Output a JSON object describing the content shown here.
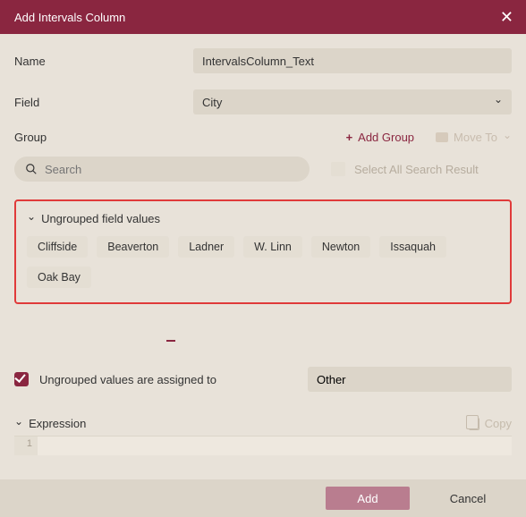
{
  "titlebar": {
    "title": "Add Intervals Column"
  },
  "fields": {
    "name_label": "Name",
    "name_value": "IntervalsColumn_Text",
    "field_label": "Field",
    "field_value": "City"
  },
  "group": {
    "label": "Group",
    "add_group": "Add Group",
    "move_to": "Move To"
  },
  "search": {
    "placeholder": "Search",
    "select_all": "Select All Search Result"
  },
  "ungrouped": {
    "title": "Ungrouped field values",
    "values": [
      "Cliffside",
      "Beaverton",
      "Ladner",
      "W. Linn",
      "Newton",
      "Issaquah",
      "Oak Bay"
    ]
  },
  "assign": {
    "label": "Ungrouped values are assigned to",
    "value": "Other"
  },
  "expression": {
    "label": "Expression",
    "copy": "Copy",
    "line_no": "1"
  },
  "footer": {
    "add": "Add",
    "cancel": "Cancel"
  }
}
